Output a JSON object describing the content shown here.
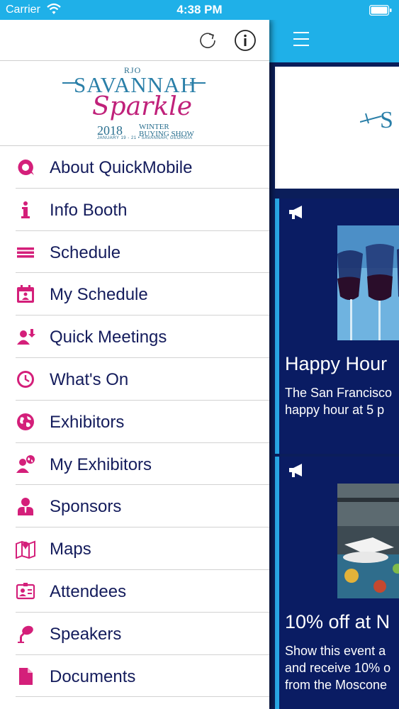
{
  "status_bar": {
    "carrier": "Carrier",
    "time": "4:38 PM"
  },
  "drawer": {
    "logo": {
      "brand": "RJO",
      "title": "SAVANNAH",
      "script": "Sparkle",
      "year": "2018",
      "line1": "WINTER",
      "line2": "BUYING SHOW",
      "sub": "JANUARY 19 - 21 • SAVANNAH, GEORGIA"
    },
    "menu_items": [
      {
        "label": "About QuickMobile",
        "icon": "quickmobile-icon"
      },
      {
        "label": "Info Booth",
        "icon": "info-icon"
      },
      {
        "label": "Schedule",
        "icon": "list-icon"
      },
      {
        "label": "My Schedule",
        "icon": "my-schedule-icon"
      },
      {
        "label": "Quick Meetings",
        "icon": "quick-meetings-icon"
      },
      {
        "label": "What's On",
        "icon": "clock-icon"
      },
      {
        "label": "Exhibitors",
        "icon": "globe-icon"
      },
      {
        "label": "My Exhibitors",
        "icon": "my-exhibitors-icon"
      },
      {
        "label": "Sponsors",
        "icon": "sponsor-icon"
      },
      {
        "label": "Maps",
        "icon": "map-icon"
      },
      {
        "label": "Attendees",
        "icon": "attendee-card-icon"
      },
      {
        "label": "Speakers",
        "icon": "microphone-icon"
      },
      {
        "label": "Documents",
        "icon": "document-icon"
      }
    ]
  },
  "feed": {
    "cards": [
      {
        "title": "Happy Hour",
        "text_line1": "The San Francisco",
        "text_line2": "happy hour at 5 p"
      },
      {
        "title": "10% off at N",
        "text_line1": "Show this event a",
        "text_line2": "and receive 10% o",
        "text_line3": "from the Moscone"
      }
    ]
  },
  "colors": {
    "accent_blue": "#1fb0e8",
    "icon_magenta": "#d41f7a",
    "menu_text": "#141c5c",
    "feed_background": "#0b1e5a"
  }
}
